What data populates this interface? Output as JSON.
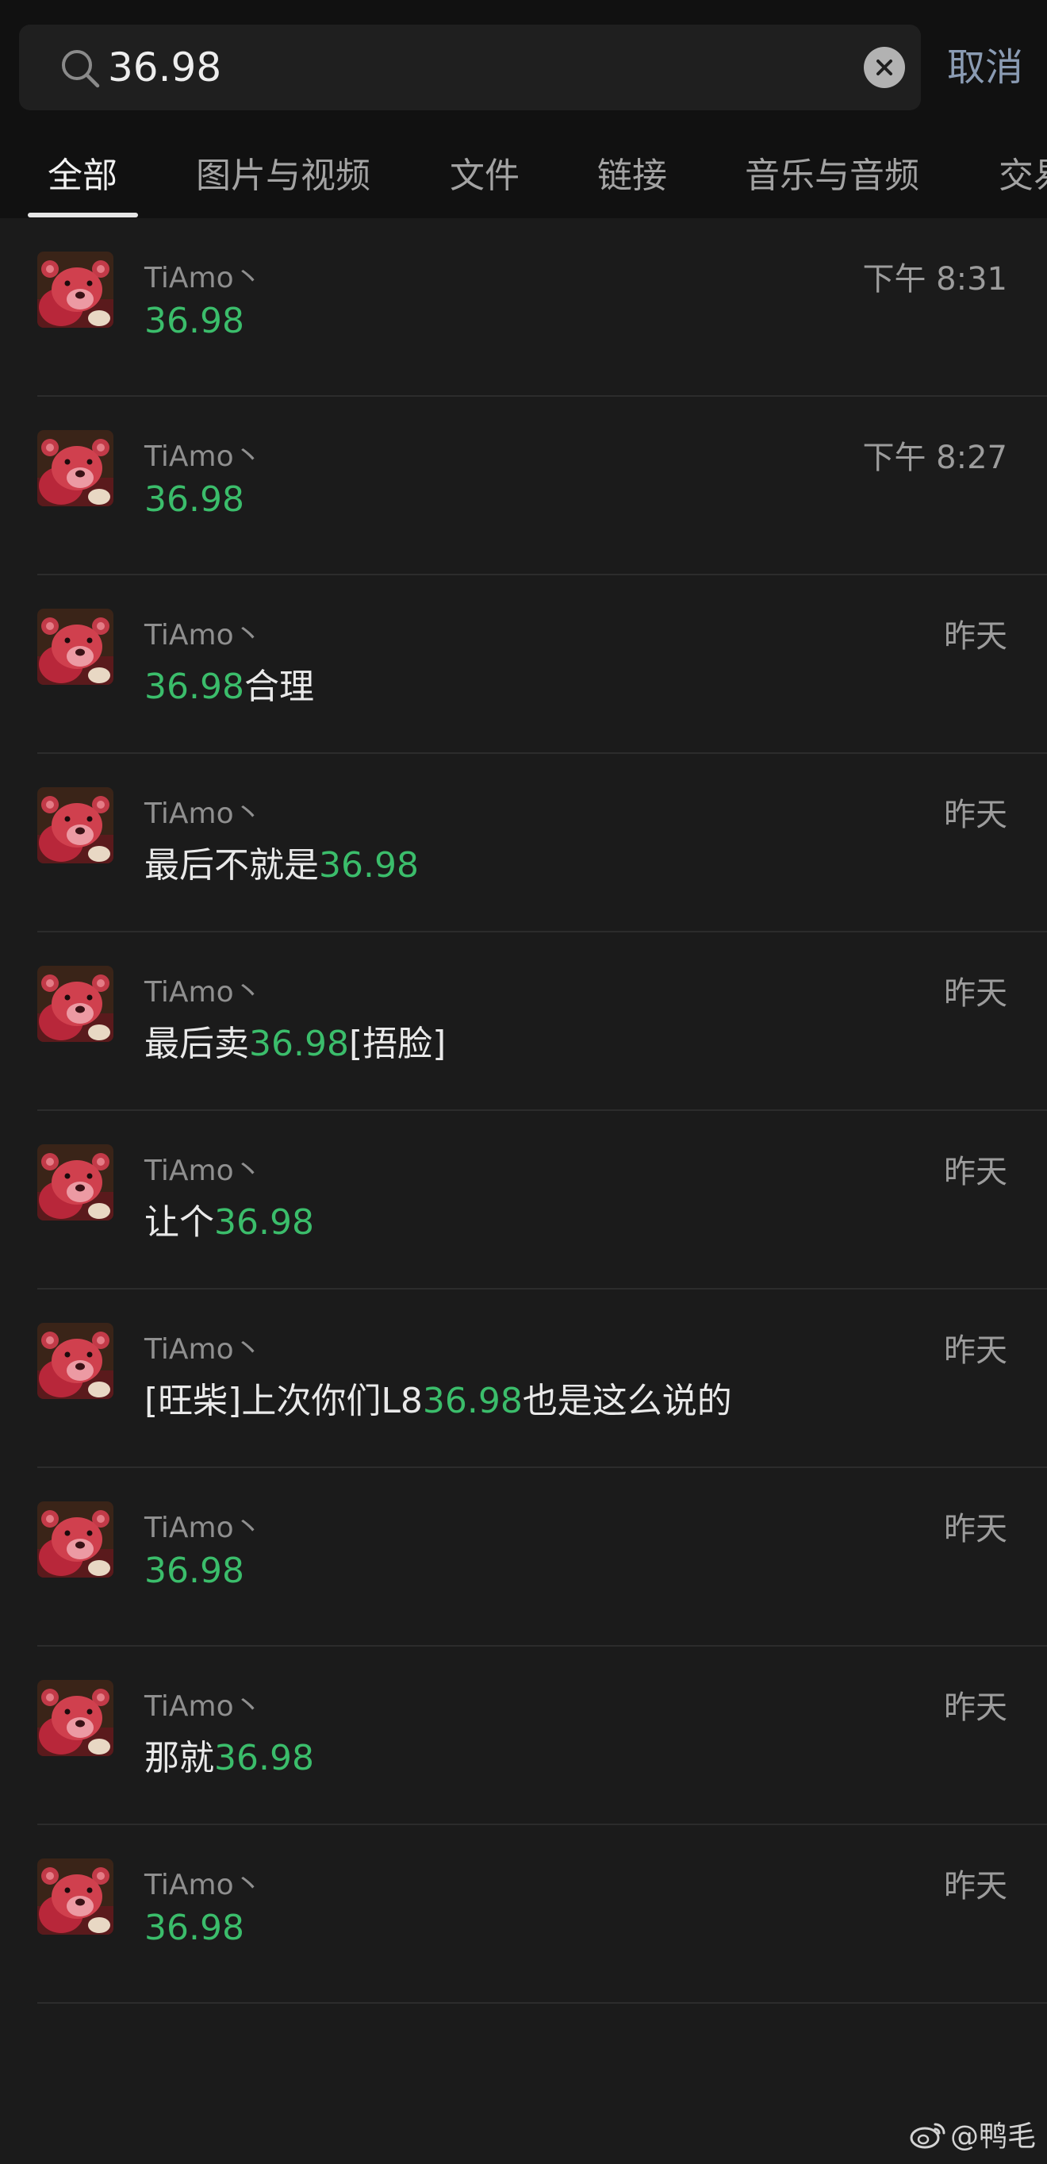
{
  "search": {
    "value": "36.98",
    "cancel_label": "取消"
  },
  "tabs": [
    {
      "label": "全部",
      "active": true
    },
    {
      "label": "图片与视频",
      "active": false
    },
    {
      "label": "文件",
      "active": false
    },
    {
      "label": "链接",
      "active": false
    },
    {
      "label": "音乐与音频",
      "active": false
    },
    {
      "label": "交易",
      "active": false
    }
  ],
  "results": [
    {
      "sender": "TiAmo丶",
      "time": "下午 8:31",
      "parts": [
        {
          "text": "36.98",
          "hl": true
        }
      ]
    },
    {
      "sender": "TiAmo丶",
      "time": "下午 8:27",
      "parts": [
        {
          "text": "36.98",
          "hl": true
        }
      ]
    },
    {
      "sender": "TiAmo丶",
      "time": "昨天",
      "parts": [
        {
          "text": "36.98",
          "hl": true
        },
        {
          "text": "合理",
          "hl": false
        }
      ]
    },
    {
      "sender": "TiAmo丶",
      "time": "昨天",
      "parts": [
        {
          "text": "最后不就是",
          "hl": false
        },
        {
          "text": "36.98",
          "hl": true
        }
      ]
    },
    {
      "sender": "TiAmo丶",
      "time": "昨天",
      "parts": [
        {
          "text": "最后卖",
          "hl": false
        },
        {
          "text": "36.98",
          "hl": true
        },
        {
          "text": "[捂脸]",
          "hl": false
        }
      ]
    },
    {
      "sender": "TiAmo丶",
      "time": "昨天",
      "parts": [
        {
          "text": "让个",
          "hl": false
        },
        {
          "text": "36.98",
          "hl": true
        }
      ]
    },
    {
      "sender": "TiAmo丶",
      "time": "昨天",
      "parts": [
        {
          "text": "[旺柴]上次你们L8",
          "hl": false
        },
        {
          "text": "36.98",
          "hl": true
        },
        {
          "text": "也是这么说的",
          "hl": false
        }
      ]
    },
    {
      "sender": "TiAmo丶",
      "time": "昨天",
      "parts": [
        {
          "text": "36.98",
          "hl": true
        }
      ]
    },
    {
      "sender": "TiAmo丶",
      "time": "昨天",
      "parts": [
        {
          "text": "那就",
          "hl": false
        },
        {
          "text": "36.98",
          "hl": true
        }
      ]
    },
    {
      "sender": "TiAmo丶",
      "time": "昨天",
      "parts": [
        {
          "text": "36.98",
          "hl": true
        }
      ]
    }
  ],
  "watermark": {
    "text": "@鸭毛"
  },
  "colors": {
    "highlight": "#3bbd6b",
    "background": "#1b1b1b",
    "header_background": "#111111",
    "cancel": "#8a9bb3"
  },
  "icons": {
    "search": "search-icon",
    "clear": "clear-icon",
    "avatar": "teddy-bear-avatar",
    "watermark": "weibo-icon"
  }
}
